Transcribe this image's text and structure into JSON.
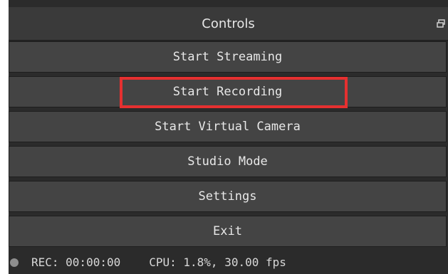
{
  "dock": {
    "title": "Controls",
    "undock_icon": "float-window-icon"
  },
  "buttons": {
    "start_streaming": "Start Streaming",
    "start_recording": "Start Recording",
    "start_virtual_camera": "Start Virtual Camera",
    "studio_mode": "Studio Mode",
    "settings": "Settings",
    "exit": "Exit"
  },
  "status": {
    "rec": "REC: 00:00:00",
    "cpu": "CPU: 1.8%, 30.00 fps"
  },
  "colors": {
    "highlight": "#e53030",
    "panel_bg": "#2b2b2b",
    "button_bg": "#444444"
  }
}
